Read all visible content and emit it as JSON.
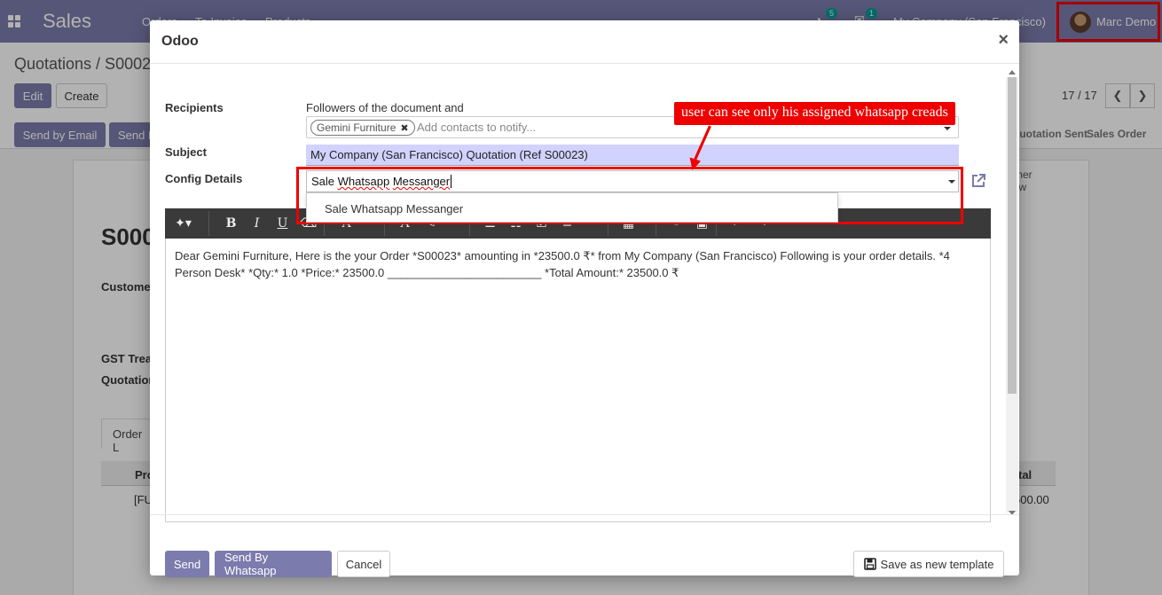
{
  "navbar": {
    "app_name": "Sales",
    "menu": [
      "Orders",
      "To Invoice",
      "Products"
    ],
    "activity_count": "5",
    "message_count": "1",
    "company": "My Company (San Francisco)",
    "user": "Marc Demo"
  },
  "control_panel": {
    "breadcrumb": "Quotations / S00023",
    "edit_label": "Edit",
    "create_label": "Create",
    "send_email_label": "Send by Email",
    "send_label2": "Send E",
    "pager": "17 / 17",
    "statuses": [
      "Quotation Sent",
      "Sales Order"
    ]
  },
  "sheet": {
    "big_title": "S000",
    "customer_label": "Custome",
    "gst_label": "GST Trea",
    "quotation_label": "Quotation",
    "tab_label": "Order L",
    "col_product": "Pro",
    "col_total": "tal",
    "row_product": "[FU",
    "row_total": "500.00",
    "button_box": "tomer\nview"
  },
  "dialog": {
    "title": "Odoo",
    "recipients_label": "Recipients",
    "recipients_text": "Followers of the document and",
    "recipient_tag": "Gemini Furniture",
    "contacts_placeholder": "Add contacts to notify...",
    "subject_label": "Subject",
    "subject_value": "My Company (San Francisco) Quotation (Ref S00023)",
    "config_label": "Config Details",
    "config_value_a": "Sale ",
    "config_value_b": "Whatsapp",
    "config_value_c": " ",
    "config_value_d": "Messanger",
    "dropdown_option": "Sale Whatsapp Messanger",
    "toolbar_bold": "B",
    "toolbar_italic": "I",
    "toolbar_underline": "U",
    "body_text": "Dear Gemini Furniture, Here is the your Order *S00023* amounting in *23500.0 ₹* from My Company (San Francisco) Following is your order details. *4 Person Desk* *Qty:* 1.0 *Price:* 23500.0 ________________________ *Total Amount:* 23500.0 ₹",
    "send_label": "Send",
    "send_whatsapp_label": "Send By Whatsapp",
    "cancel_label": "Cancel",
    "save_template_label": "Save as new template"
  },
  "annotation": {
    "text": "user can see only his assigned whatsapp creads",
    "color": "#ee0000"
  },
  "colors": {
    "brand": "#7c7bad",
    "highlight": "#ee0000"
  }
}
